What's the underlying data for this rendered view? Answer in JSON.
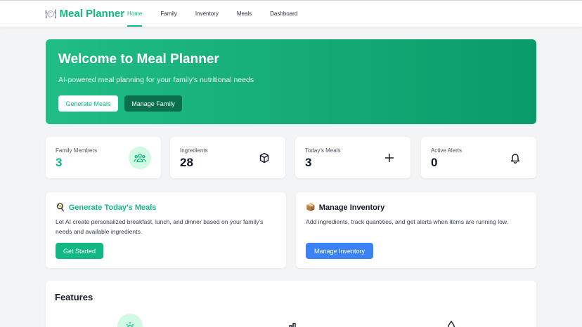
{
  "brand": {
    "icon": "fork-knife-plate-icon",
    "title": "Meal Planner"
  },
  "nav": {
    "items": [
      {
        "label": "Home",
        "active": true
      },
      {
        "label": "Family",
        "active": false
      },
      {
        "label": "Inventory",
        "active": false
      },
      {
        "label": "Meals",
        "active": false
      },
      {
        "label": "Dashboard",
        "active": false
      }
    ]
  },
  "hero": {
    "title": "Welcome to Meal Planner",
    "subtitle": "AI-powered meal planning for your family's nutritional needs",
    "primary_button": "Generate Meals",
    "secondary_button": "Manage Family"
  },
  "stats": [
    {
      "label": "Family Members",
      "value": "3",
      "icon": "users-icon"
    },
    {
      "label": "Ingredients",
      "value": "28",
      "icon": "cube-icon"
    },
    {
      "label": "Today's Meals",
      "value": "3",
      "icon": "plus-icon"
    },
    {
      "label": "Active Alerts",
      "value": "0",
      "icon": "bell-icon"
    }
  ],
  "cards": [
    {
      "icon": "magnifier-icon",
      "title": "Generate Today's Meals",
      "description": "Let AI create personalized breakfast, lunch, and dinner based on your family's needs and available ingredients.",
      "button": "Get Started"
    },
    {
      "icon": "package-icon",
      "title": "Manage Inventory",
      "description": "Add ingredients, track quantities, and get alerts when items are running low.",
      "button": "Manage Inventory"
    }
  ],
  "features": {
    "title": "Features",
    "icons": [
      "sun-icon",
      "bar-chart-icon",
      "droplet-icon"
    ]
  },
  "colors": {
    "accent": "#10b981",
    "accent_dark": "#0b6e4c",
    "blue": "#3b82f6",
    "background": "#f3f4f6"
  }
}
